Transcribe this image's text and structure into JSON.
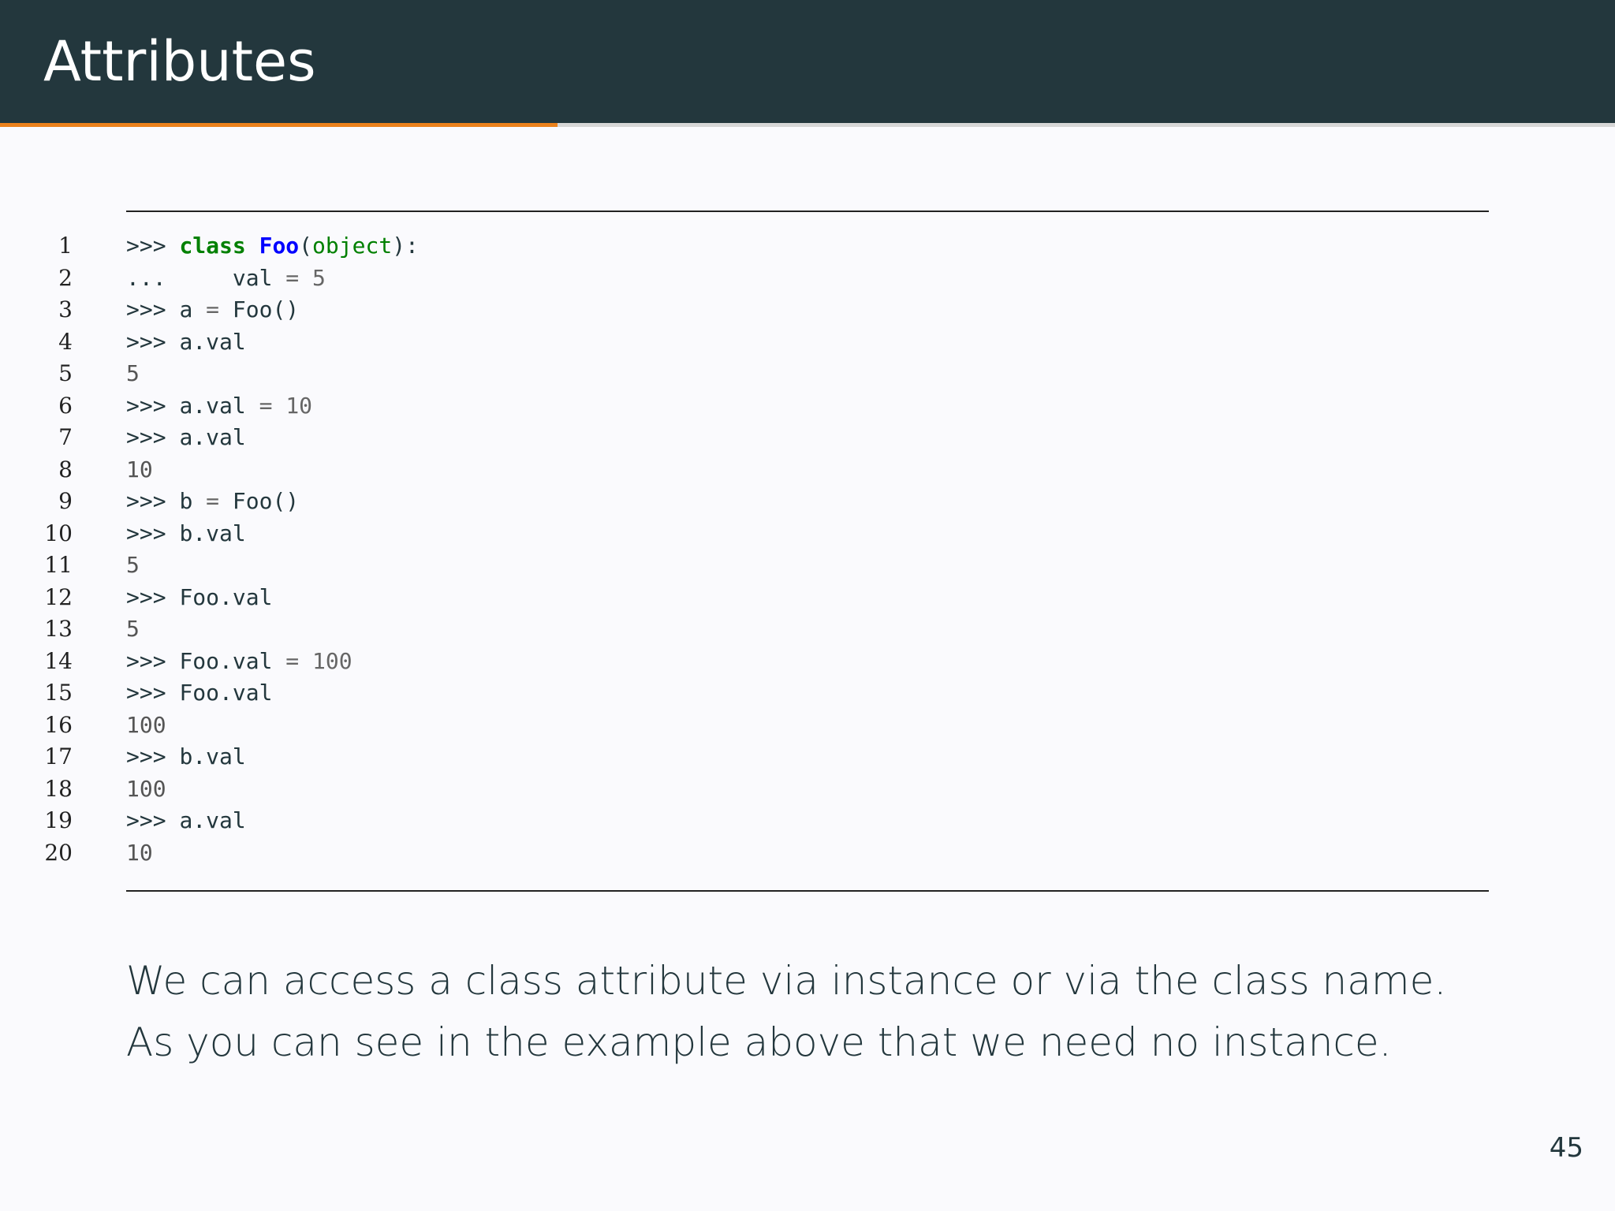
{
  "slide": {
    "title": "Attributes",
    "progress": 0.345,
    "paragraph": "We can access a class attribute via instance or via the class name. As you can see in the example above that we need no instance.",
    "page_number": "45"
  },
  "code_lines": [
    {
      "num": "1",
      "tokens": [
        {
          "t": ">>> ",
          "c": "prompt"
        },
        {
          "t": "class",
          "c": "kw"
        },
        {
          "t": " ",
          "c": ""
        },
        {
          "t": "Foo",
          "c": "cls"
        },
        {
          "t": "(",
          "c": ""
        },
        {
          "t": "object",
          "c": "builtin"
        },
        {
          "t": "):",
          "c": ""
        }
      ]
    },
    {
      "num": "2",
      "tokens": [
        {
          "t": "...     ",
          "c": "prompt"
        },
        {
          "t": "val ",
          "c": ""
        },
        {
          "t": "=",
          "c": "op"
        },
        {
          "t": " ",
          "c": ""
        },
        {
          "t": "5",
          "c": "num"
        }
      ]
    },
    {
      "num": "3",
      "tokens": [
        {
          "t": ">>> ",
          "c": "prompt"
        },
        {
          "t": "a ",
          "c": ""
        },
        {
          "t": "=",
          "c": "op"
        },
        {
          "t": " Foo()",
          "c": ""
        }
      ]
    },
    {
      "num": "4",
      "tokens": [
        {
          "t": ">>> ",
          "c": "prompt"
        },
        {
          "t": "a.val",
          "c": ""
        }
      ]
    },
    {
      "num": "5",
      "tokens": [
        {
          "t": "5",
          "c": "out"
        }
      ]
    },
    {
      "num": "6",
      "tokens": [
        {
          "t": ">>> ",
          "c": "prompt"
        },
        {
          "t": "a.val ",
          "c": ""
        },
        {
          "t": "=",
          "c": "op"
        },
        {
          "t": " ",
          "c": ""
        },
        {
          "t": "10",
          "c": "num"
        }
      ]
    },
    {
      "num": "7",
      "tokens": [
        {
          "t": ">>> ",
          "c": "prompt"
        },
        {
          "t": "a.val",
          "c": ""
        }
      ]
    },
    {
      "num": "8",
      "tokens": [
        {
          "t": "10",
          "c": "out"
        }
      ]
    },
    {
      "num": "9",
      "tokens": [
        {
          "t": ">>> ",
          "c": "prompt"
        },
        {
          "t": "b ",
          "c": ""
        },
        {
          "t": "=",
          "c": "op"
        },
        {
          "t": " Foo()",
          "c": ""
        }
      ]
    },
    {
      "num": "10",
      "tokens": [
        {
          "t": ">>> ",
          "c": "prompt"
        },
        {
          "t": "b.val",
          "c": ""
        }
      ]
    },
    {
      "num": "11",
      "tokens": [
        {
          "t": "5",
          "c": "out"
        }
      ]
    },
    {
      "num": "12",
      "tokens": [
        {
          "t": ">>> ",
          "c": "prompt"
        },
        {
          "t": "Foo.val",
          "c": ""
        }
      ]
    },
    {
      "num": "13",
      "tokens": [
        {
          "t": "5",
          "c": "out"
        }
      ]
    },
    {
      "num": "14",
      "tokens": [
        {
          "t": ">>> ",
          "c": "prompt"
        },
        {
          "t": "Foo.val ",
          "c": ""
        },
        {
          "t": "=",
          "c": "op"
        },
        {
          "t": " ",
          "c": ""
        },
        {
          "t": "100",
          "c": "num"
        }
      ]
    },
    {
      "num": "15",
      "tokens": [
        {
          "t": ">>> ",
          "c": "prompt"
        },
        {
          "t": "Foo.val",
          "c": ""
        }
      ]
    },
    {
      "num": "16",
      "tokens": [
        {
          "t": "100",
          "c": "out"
        }
      ]
    },
    {
      "num": "17",
      "tokens": [
        {
          "t": ">>> ",
          "c": "prompt"
        },
        {
          "t": "b.val",
          "c": ""
        }
      ]
    },
    {
      "num": "18",
      "tokens": [
        {
          "t": "100",
          "c": "out"
        }
      ]
    },
    {
      "num": "19",
      "tokens": [
        {
          "t": ">>> ",
          "c": "prompt"
        },
        {
          "t": "a.val",
          "c": ""
        }
      ]
    },
    {
      "num": "20",
      "tokens": [
        {
          "t": "10",
          "c": "out"
        }
      ]
    }
  ],
  "colors": {
    "header_bg": "#23373d",
    "accent": "#eb811b",
    "keyword": "#008000",
    "class_name": "#0000ff",
    "number": "#666666"
  }
}
